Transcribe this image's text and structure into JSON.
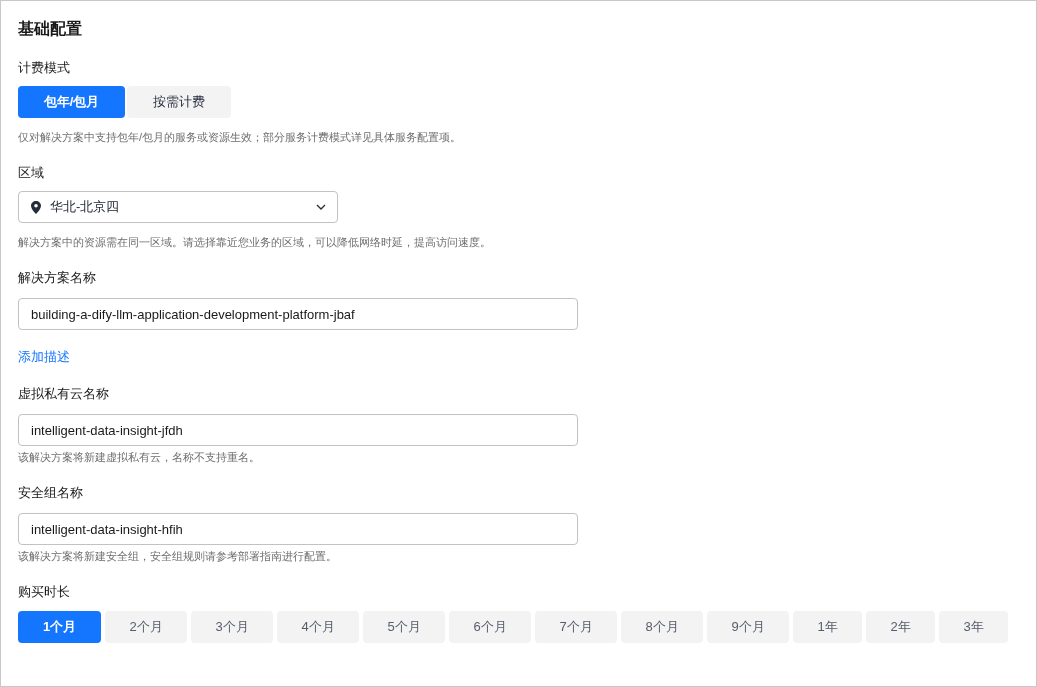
{
  "section_title": "基础配置",
  "billing": {
    "label": "计费模式",
    "options": [
      {
        "label": "包年/包月",
        "selected": true
      },
      {
        "label": "按需计费",
        "selected": false
      }
    ],
    "hint": "仅对解决方案中支持包年/包月的服务或资源生效；部分服务计费模式详见具体服务配置项。"
  },
  "region": {
    "label": "区域",
    "value": "华北-北京四",
    "hint": "解决方案中的资源需在同一区域。请选择靠近您业务的区域，可以降低网络时延，提高访问速度。"
  },
  "solution_name": {
    "label": "解决方案名称",
    "value": "building-a-dify-llm-application-development-platform-jbaf"
  },
  "add_description_link": "添加描述",
  "vpc_name": {
    "label": "虚拟私有云名称",
    "value": "intelligent-data-insight-jfdh",
    "hint": "该解决方案将新建虚拟私有云，名称不支持重名。"
  },
  "security_group_name": {
    "label": "安全组名称",
    "value": "intelligent-data-insight-hfih",
    "hint": "该解决方案将新建安全组，安全组规则请参考部署指南进行配置。"
  },
  "duration": {
    "label": "购买时长",
    "options": [
      {
        "label": "1个月",
        "kind": "month",
        "selected": true
      },
      {
        "label": "2个月",
        "kind": "month",
        "selected": false
      },
      {
        "label": "3个月",
        "kind": "month",
        "selected": false
      },
      {
        "label": "4个月",
        "kind": "month",
        "selected": false
      },
      {
        "label": "5个月",
        "kind": "month",
        "selected": false
      },
      {
        "label": "6个月",
        "kind": "month",
        "selected": false
      },
      {
        "label": "7个月",
        "kind": "month",
        "selected": false
      },
      {
        "label": "8个月",
        "kind": "month",
        "selected": false
      },
      {
        "label": "9个月",
        "kind": "month",
        "selected": false
      },
      {
        "label": "1年",
        "kind": "year",
        "selected": false
      },
      {
        "label": "2年",
        "kind": "year",
        "selected": false
      },
      {
        "label": "3年",
        "kind": "year",
        "selected": false
      }
    ]
  }
}
